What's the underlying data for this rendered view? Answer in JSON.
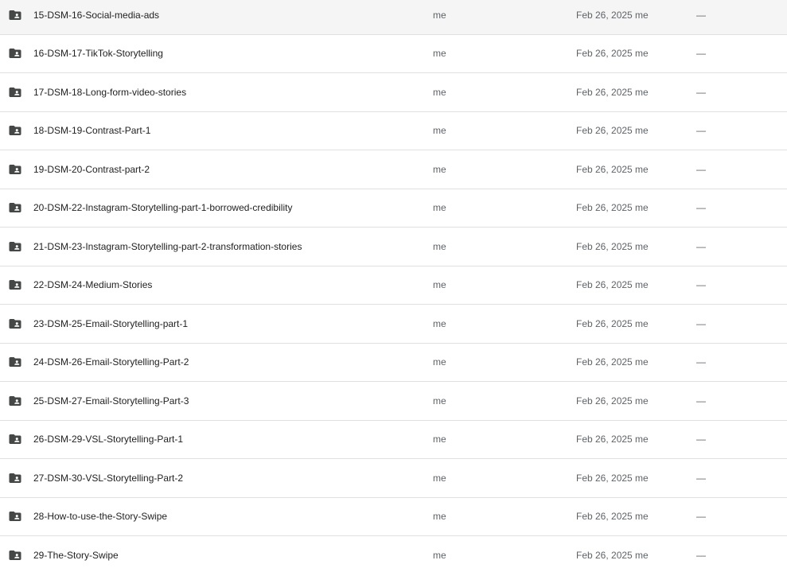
{
  "colors": {
    "folder_icon": "#444746",
    "row_divider": "#e0e0e0",
    "secondary_text": "#5f6368",
    "primary_text": "#1f1f1f"
  },
  "rows": [
    {
      "icon": "shared-folder-icon",
      "name": "15-DSM-16-Social-media-ads",
      "owner": "me",
      "modified": "Feb 26, 2025 me",
      "size": "—"
    },
    {
      "icon": "shared-folder-icon",
      "name": "16-DSM-17-TikTok-Storytelling",
      "owner": "me",
      "modified": "Feb 26, 2025 me",
      "size": "—"
    },
    {
      "icon": "shared-folder-icon",
      "name": "17-DSM-18-Long-form-video-stories",
      "owner": "me",
      "modified": "Feb 26, 2025 me",
      "size": "—"
    },
    {
      "icon": "shared-folder-icon",
      "name": "18-DSM-19-Contrast-Part-1",
      "owner": "me",
      "modified": "Feb 26, 2025 me",
      "size": "—"
    },
    {
      "icon": "shared-folder-icon",
      "name": "19-DSM-20-Contrast-part-2",
      "owner": "me",
      "modified": "Feb 26, 2025 me",
      "size": "—"
    },
    {
      "icon": "shared-folder-icon",
      "name": "20-DSM-22-Instagram-Storytelling-part-1-borrowed-credibility",
      "owner": "me",
      "modified": "Feb 26, 2025 me",
      "size": "—"
    },
    {
      "icon": "shared-folder-icon",
      "name": "21-DSM-23-Instagram-Storytelling-part-2-transformation-stories",
      "owner": "me",
      "modified": "Feb 26, 2025 me",
      "size": "—"
    },
    {
      "icon": "shared-folder-icon",
      "name": "22-DSM-24-Medium-Stories",
      "owner": "me",
      "modified": "Feb 26, 2025 me",
      "size": "—"
    },
    {
      "icon": "shared-folder-icon",
      "name": "23-DSM-25-Email-Storytelling-part-1",
      "owner": "me",
      "modified": "Feb 26, 2025 me",
      "size": "—"
    },
    {
      "icon": "shared-folder-icon",
      "name": "24-DSM-26-Email-Storytelling-Part-2",
      "owner": "me",
      "modified": "Feb 26, 2025 me",
      "size": "—"
    },
    {
      "icon": "shared-folder-icon",
      "name": "25-DSM-27-Email-Storytelling-Part-3",
      "owner": "me",
      "modified": "Feb 26, 2025 me",
      "size": "—"
    },
    {
      "icon": "shared-folder-icon",
      "name": "26-DSM-29-VSL-Storytelling-Part-1",
      "owner": "me",
      "modified": "Feb 26, 2025 me",
      "size": "—"
    },
    {
      "icon": "shared-folder-icon",
      "name": "27-DSM-30-VSL-Storytelling-Part-2",
      "owner": "me",
      "modified": "Feb 26, 2025 me",
      "size": "—"
    },
    {
      "icon": "shared-folder-icon",
      "name": "28-How-to-use-the-Story-Swipe",
      "owner": "me",
      "modified": "Feb 26, 2025 me",
      "size": "—"
    },
    {
      "icon": "shared-folder-icon",
      "name": "29-The-Story-Swipe",
      "owner": "me",
      "modified": "Feb 26, 2025 me",
      "size": "—"
    }
  ]
}
